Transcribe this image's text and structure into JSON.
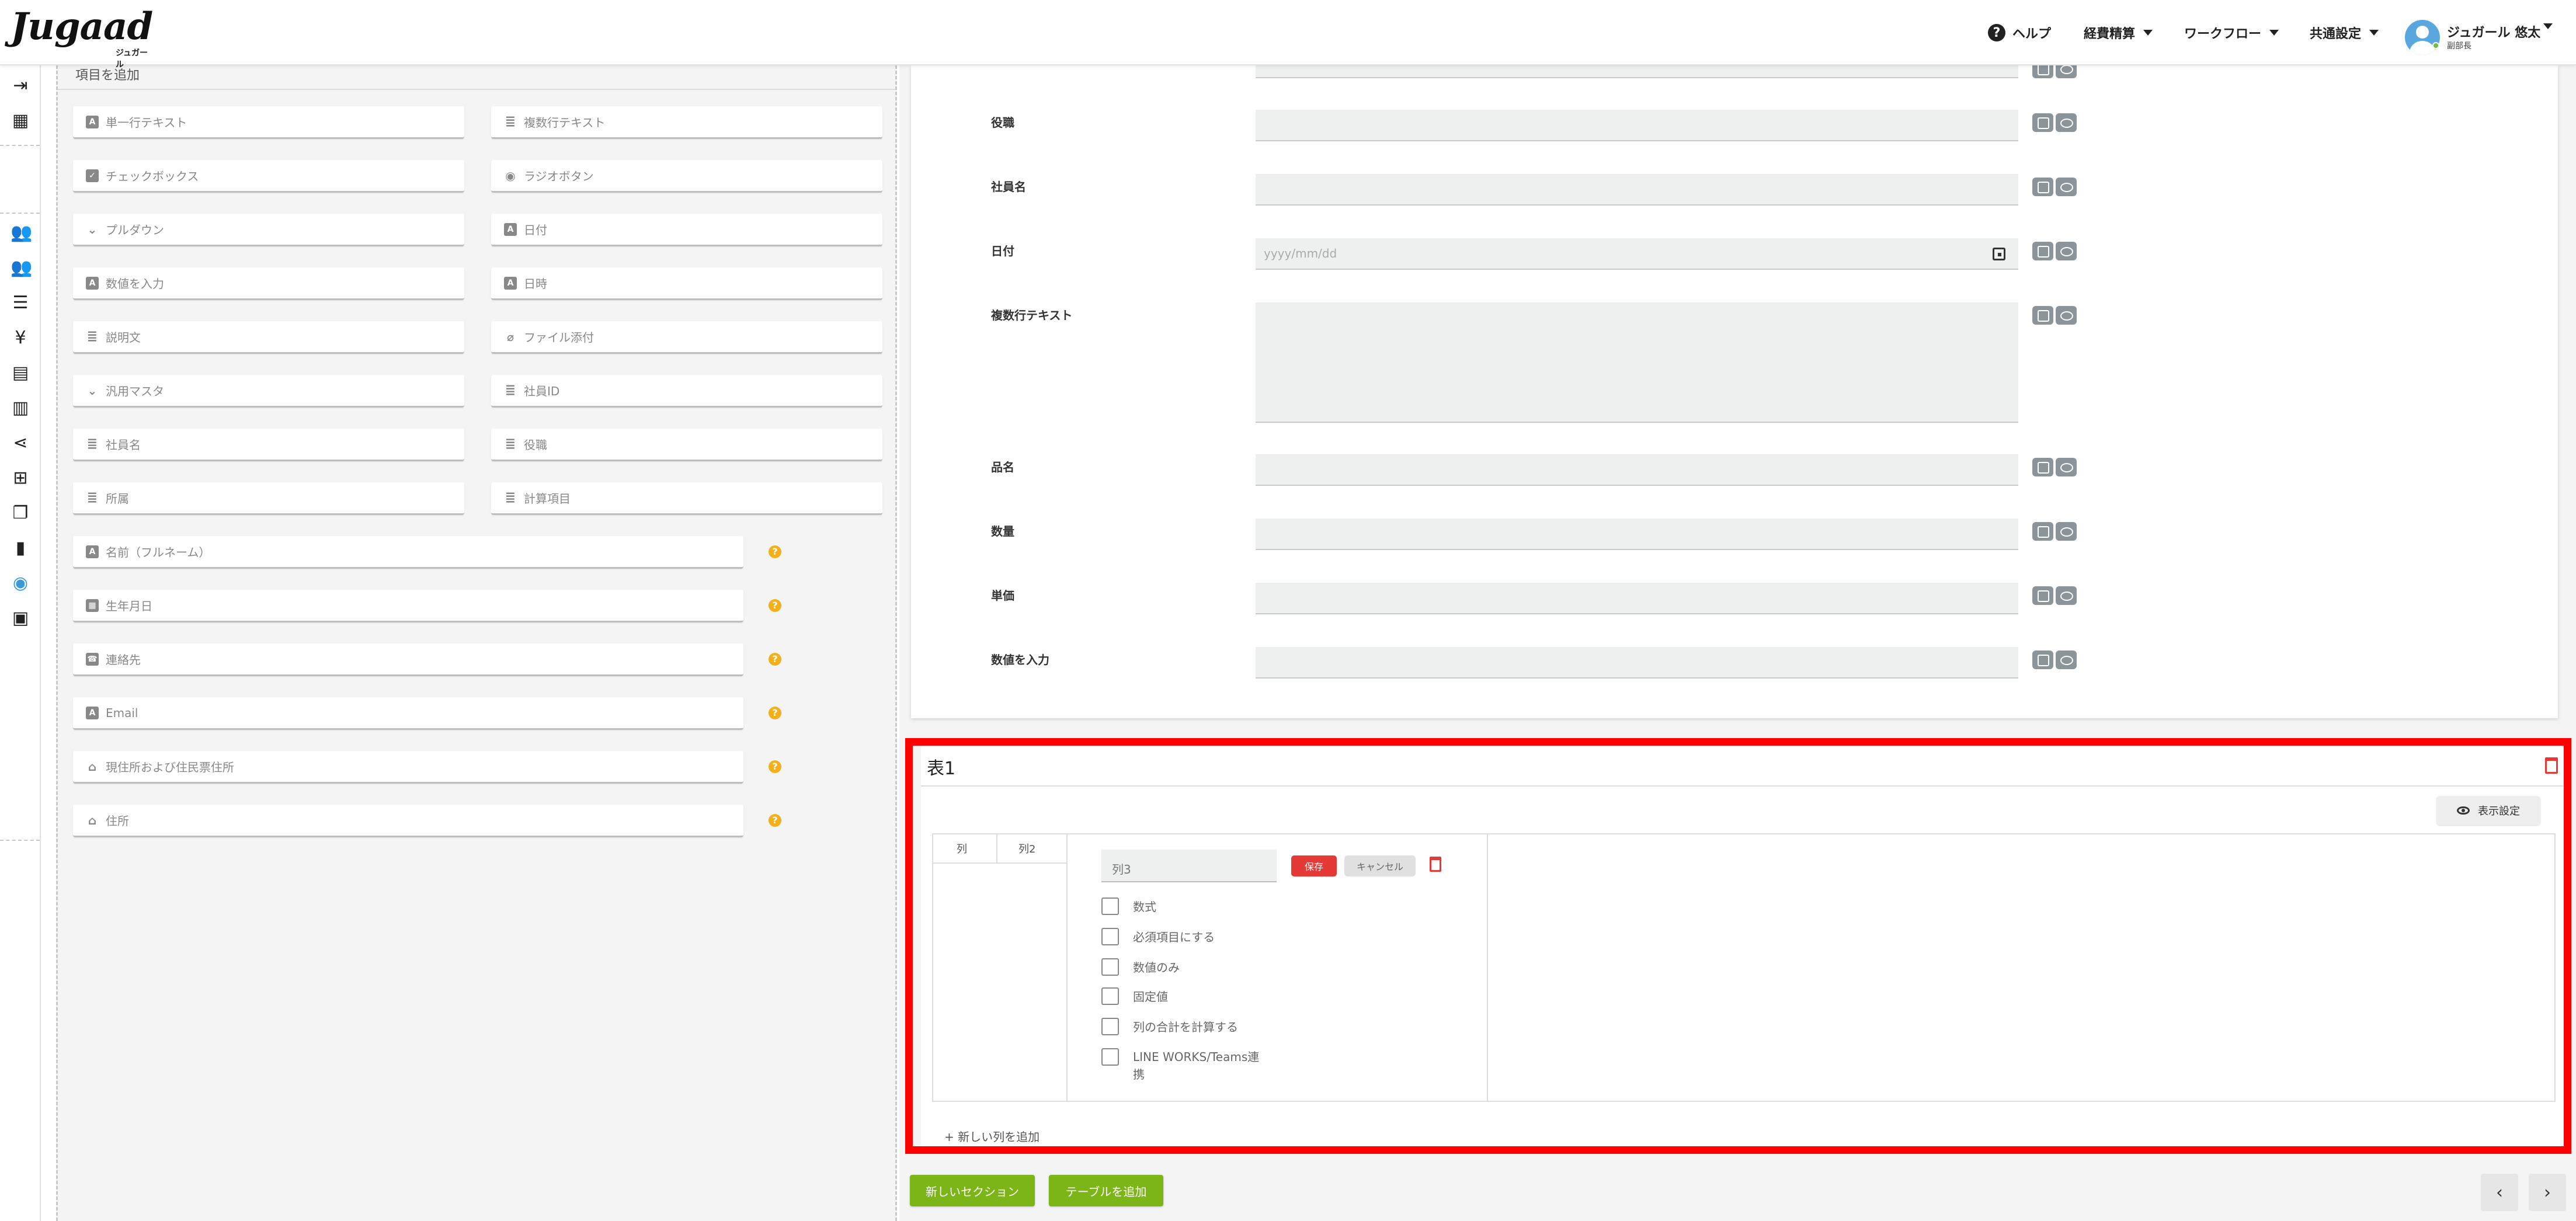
{
  "header": {
    "logo_text": "Jugaad",
    "logo_sub": "ジュガール",
    "nav": {
      "help": "ヘルプ",
      "expense": "経費精算",
      "workflow": "ワークフロー",
      "common": "共通設定"
    },
    "user_name": "ジュガール 悠太",
    "user_role": "副部長"
  },
  "left_panel": {
    "title": "項目を追加",
    "fields": [
      {
        "label": "単一行テキスト",
        "icon": "text-box-icon"
      },
      {
        "label": "複数行テキスト",
        "icon": "lines-icon"
      },
      {
        "label": "チェックボックス",
        "icon": "checkbox-icon"
      },
      {
        "label": "ラジオボタン",
        "icon": "radio-icon"
      },
      {
        "label": "プルダウン",
        "icon": "chevron-down-icon"
      },
      {
        "label": "日付",
        "icon": "text-box-icon"
      },
      {
        "label": "数値を入力",
        "icon": "text-box-icon"
      },
      {
        "label": "日時",
        "icon": "text-box-icon"
      },
      {
        "label": "説明文",
        "icon": "lines-icon"
      },
      {
        "label": "ファイル添付",
        "icon": "paperclip-icon"
      },
      {
        "label": "汎用マスタ",
        "icon": "chevron-down-icon"
      },
      {
        "label": "社員ID",
        "icon": "lines-icon"
      },
      {
        "label": "社員名",
        "icon": "lines-icon"
      },
      {
        "label": "役職",
        "icon": "lines-icon"
      },
      {
        "label": "所属",
        "icon": "lines-icon"
      },
      {
        "label": "計算項目",
        "icon": "lines-icon"
      }
    ],
    "wide_fields": [
      {
        "label": "名前（フルネーム）",
        "icon": "text-box-icon"
      },
      {
        "label": "生年月日",
        "icon": "calendar-icon"
      },
      {
        "label": "連絡先",
        "icon": "phone-icon"
      },
      {
        "label": "Email",
        "icon": "text-box-icon"
      },
      {
        "label": "現住所および住民票住所",
        "icon": "house-icon"
      },
      {
        "label": "住所",
        "icon": "house-icon"
      }
    ]
  },
  "form": {
    "rows": [
      {
        "label": "役職",
        "placeholder": ""
      },
      {
        "label": "社員名",
        "placeholder": ""
      },
      {
        "label": "日付",
        "placeholder": "yyyy/mm/dd"
      },
      {
        "label": "複数行テキスト",
        "placeholder": ""
      },
      {
        "label": "品名",
        "placeholder": ""
      },
      {
        "label": "数量",
        "placeholder": ""
      },
      {
        "label": "単価",
        "placeholder": ""
      },
      {
        "label": "数値を入力",
        "placeholder": ""
      }
    ]
  },
  "table_section": {
    "title": "表1",
    "display_settings": "表示設定",
    "columns": [
      "列",
      "列2"
    ],
    "edit_column_value": "列3",
    "save_label": "保存",
    "cancel_label": "キャンセル",
    "options": [
      "数式",
      "必須項目にする",
      "数値のみ",
      "固定値",
      "列の合計を計算する",
      "LINE WORKS/Teams連携"
    ],
    "add_column": "+ 新しい列を追加"
  },
  "bottom": {
    "new_section": "新しいセクション",
    "add_table": "テーブルを追加",
    "prev": "‹",
    "next": "›"
  }
}
